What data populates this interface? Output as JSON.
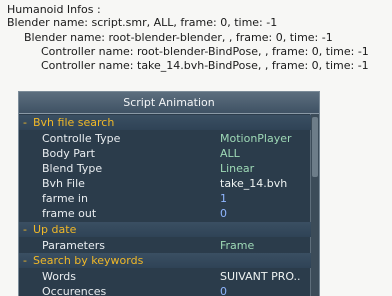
{
  "info": {
    "header": "Humanoid Infos :",
    "blender_line": "Blender name: script.smr, ALL, frame: 0, time: -1",
    "child_blender_line": "Blender name: root-blender-blender, , frame: 0, time: -1",
    "controller_1": "Controller name: root-blender-BindPose, , frame: 0, time: -1",
    "controller_2": "Controller name: take_14.bvh-BindPose, , frame: 0, time: -1"
  },
  "panel": {
    "title": "Script Animation",
    "sections": [
      {
        "toggle": "-",
        "label": "Bvh file search",
        "rows": [
          {
            "label": "Controlle Type",
            "value": "MotionPlayer"
          },
          {
            "label": "Body Part",
            "value": "ALL"
          },
          {
            "label": "Blend Type",
            "value": "Linear"
          },
          {
            "label": "Bvh File",
            "value": "take_14.bvh"
          },
          {
            "label": "farme in",
            "value": "1"
          },
          {
            "label": "frame out",
            "value": "0"
          }
        ]
      },
      {
        "toggle": "-",
        "label": "Up date",
        "rows": [
          {
            "label": "Parameters",
            "value": "Frame"
          }
        ]
      },
      {
        "toggle": "-",
        "label": "Search by keywords",
        "rows": [
          {
            "label": "Words",
            "value": "SUIVANT PRO.."
          },
          {
            "label": "Occurences",
            "value": "0"
          }
        ]
      }
    ]
  },
  "colors": {
    "panel_bg": "#2b3c4b",
    "section_text": "#f0b828",
    "value_text": "#9ed9b6",
    "number_text": "#8fb6ff"
  }
}
